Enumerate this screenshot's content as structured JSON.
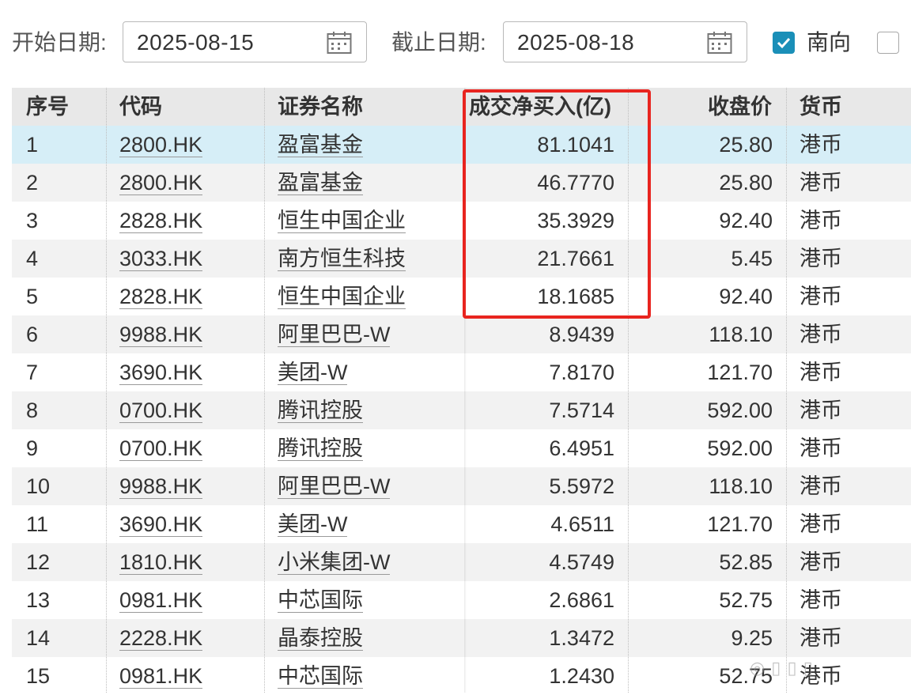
{
  "filters": {
    "start_label": "开始日期:",
    "start_value": "2025-08-15",
    "end_label": "截止日期:",
    "end_value": "2025-08-18",
    "southbound_label": "南向",
    "southbound_checked": true,
    "other_checked": false
  },
  "table": {
    "headers": {
      "index": "序号",
      "code": "代码",
      "name": "证券名称",
      "net_buy": "成交净买入(亿)",
      "close": "收盘价",
      "currency": "货币"
    },
    "rows": [
      {
        "index": "1",
        "code": "2800.HK",
        "name": "盈富基金",
        "net_buy": "81.1041",
        "close": "25.80",
        "currency": "港币"
      },
      {
        "index": "2",
        "code": "2800.HK",
        "name": "盈富基金",
        "net_buy": "46.7770",
        "close": "25.80",
        "currency": "港币"
      },
      {
        "index": "3",
        "code": "2828.HK",
        "name": "恒生中国企业",
        "net_buy": "35.3929",
        "close": "92.40",
        "currency": "港币"
      },
      {
        "index": "4",
        "code": "3033.HK",
        "name": "南方恒生科技",
        "net_buy": "21.7661",
        "close": "5.45",
        "currency": "港币"
      },
      {
        "index": "5",
        "code": "2828.HK",
        "name": "恒生中国企业",
        "net_buy": "18.1685",
        "close": "92.40",
        "currency": "港币"
      },
      {
        "index": "6",
        "code": "9988.HK",
        "name": "阿里巴巴-W",
        "net_buy": "8.9439",
        "close": "118.10",
        "currency": "港币"
      },
      {
        "index": "7",
        "code": "3690.HK",
        "name": "美团-W",
        "net_buy": "7.8170",
        "close": "121.70",
        "currency": "港币"
      },
      {
        "index": "8",
        "code": "0700.HK",
        "name": "腾讯控股",
        "net_buy": "7.5714",
        "close": "592.00",
        "currency": "港币"
      },
      {
        "index": "9",
        "code": "0700.HK",
        "name": "腾讯控股",
        "net_buy": "6.4951",
        "close": "592.00",
        "currency": "港币"
      },
      {
        "index": "10",
        "code": "9988.HK",
        "name": "阿里巴巴-W",
        "net_buy": "5.5972",
        "close": "118.10",
        "currency": "港币"
      },
      {
        "index": "11",
        "code": "3690.HK",
        "name": "美团-W",
        "net_buy": "4.6511",
        "close": "121.70",
        "currency": "港币"
      },
      {
        "index": "12",
        "code": "1810.HK",
        "name": "小米集团-W",
        "net_buy": "4.5749",
        "close": "52.85",
        "currency": "港币"
      },
      {
        "index": "13",
        "code": "0981.HK",
        "name": "中芯国际",
        "net_buy": "2.6861",
        "close": "52.75",
        "currency": "港币"
      },
      {
        "index": "14",
        "code": "2228.HK",
        "name": "晶泰控股",
        "net_buy": "1.3472",
        "close": "9.25",
        "currency": "港币"
      },
      {
        "index": "15",
        "code": "0981.HK",
        "name": "中芯国际",
        "net_buy": "1.2430",
        "close": "52.75",
        "currency": "港币"
      }
    ]
  },
  "colors": {
    "accent": "#1a8fb8",
    "highlight_box": "#e8241f",
    "selected_row": "#d6eef7",
    "header_bg": "#e8e8e8"
  },
  "icons": [
    "calendar-icon",
    "checkmark-icon"
  ]
}
